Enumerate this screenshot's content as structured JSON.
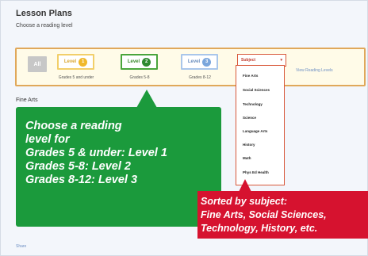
{
  "page": {
    "title": "Lesson Plans",
    "subtitle": "Choose a reading level",
    "section_label": "Fine Arts",
    "share_link": "Share"
  },
  "levels": {
    "all_label": "All",
    "items": [
      {
        "label": "Level",
        "badge": "1",
        "caption": "Grades 5 and under",
        "color": "#f0b82a"
      },
      {
        "label": "Level",
        "badge": "2",
        "caption": "Grades 5-8",
        "color": "#2f8a30"
      },
      {
        "label": "Level",
        "badge": "3",
        "caption": "Grades 8-12",
        "color": "#7aa6dc"
      }
    ]
  },
  "subject": {
    "select_label": "Subject",
    "options": [
      "Fine Arts",
      "Social Sciences",
      "Technology",
      "Science",
      "Language Arts",
      "History",
      "Math",
      "Phys Ed Health"
    ]
  },
  "view_link": "View Reading Levels",
  "callouts": {
    "green": [
      "Choose a reading",
      "level for",
      "Grades 5 & under: Level 1",
      "Grades 5-8: Level 2",
      "Grades 8-12: Level 3"
    ],
    "red": [
      "Sorted by subject:",
      "Fine Arts, Social Sciences,",
      "Technology, History, etc."
    ],
    "green_color": "#1b9a3c",
    "red_color": "#d6122f"
  }
}
